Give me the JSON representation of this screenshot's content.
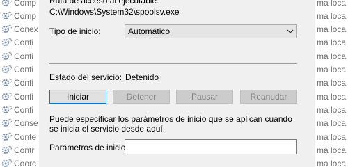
{
  "background_list": {
    "left_items": [
      "Comp",
      "Comp",
      "Conex",
      "Confi",
      "Confi",
      "Confi",
      "Confi",
      "Confi",
      "Confi",
      "Conse",
      "Conte",
      "Contr",
      "Coorc"
    ],
    "right_items": [
      "ma loca",
      "ma loca",
      "ma loca",
      "ma loca",
      "ma loca",
      "ma loca",
      "ma loca",
      "ma loca",
      "ma loca",
      "ma loca",
      "ma loca",
      "ma loca",
      "ma loca"
    ]
  },
  "dialog": {
    "path_label": "Ruta de acceso al ejecutable:",
    "path_value": "C:\\Windows\\System32\\spoolsv.exe",
    "startup_type_label": "Tipo de inicio:",
    "startup_type_value": "Automático",
    "service_status_label": "Estado del servicio:",
    "service_status_value": "Detenido",
    "buttons": {
      "start": "Iniciar",
      "stop": "Detener",
      "pause": "Pausar",
      "resume": "Reanudar"
    },
    "help_text": "Puede especificar los parámetros de inicio que se aplican cuando se inicia el servicio desde aquí.",
    "start_params_label": "Parámetros de inicio:",
    "start_params_value": ""
  },
  "colors": {
    "dialog_bg": "#f0f0f0",
    "focus_border": "#0078d7",
    "disabled_text": "#838383"
  }
}
